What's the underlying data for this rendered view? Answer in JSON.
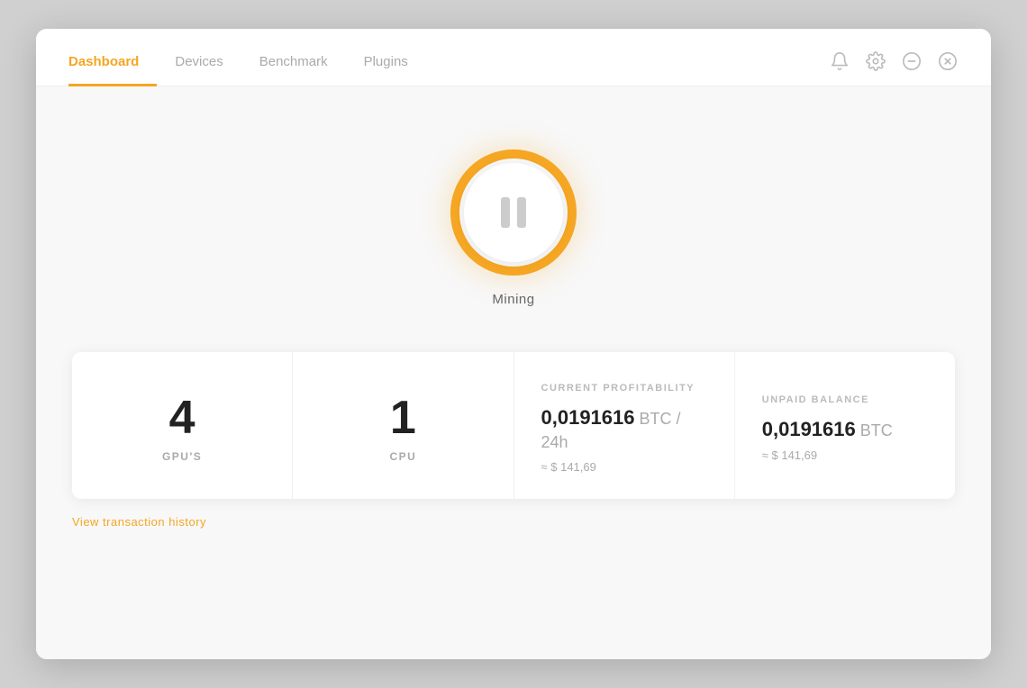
{
  "navbar": {
    "tabs": [
      {
        "id": "dashboard",
        "label": "Dashboard",
        "active": true
      },
      {
        "id": "devices",
        "label": "Devices",
        "active": false
      },
      {
        "id": "benchmark",
        "label": "Benchmark",
        "active": false
      },
      {
        "id": "plugins",
        "label": "Plugins",
        "active": false
      }
    ]
  },
  "window_controls": {
    "bell_label": "notifications",
    "settings_label": "settings",
    "minimize_label": "minimize",
    "close_label": "close"
  },
  "mining": {
    "button_label": "Mining"
  },
  "stats": [
    {
      "id": "gpus",
      "number": "4",
      "label": "GPU'S",
      "type": "count"
    },
    {
      "id": "cpu",
      "number": "1",
      "label": "CPU",
      "type": "count"
    },
    {
      "id": "profitability",
      "title": "CURRENT PROFITABILITY",
      "btc_value": "0,0191616",
      "btc_suffix": " BTC / 24h",
      "usd_value": "≈ $ 141,69",
      "type": "balance"
    },
    {
      "id": "unpaid",
      "title": "UNPAID BALANCE",
      "btc_value": "0,0191616",
      "btc_suffix": " BTC",
      "usd_value": "≈ $ 141,69",
      "type": "balance"
    }
  ],
  "bottom_hint": "View transaction history"
}
